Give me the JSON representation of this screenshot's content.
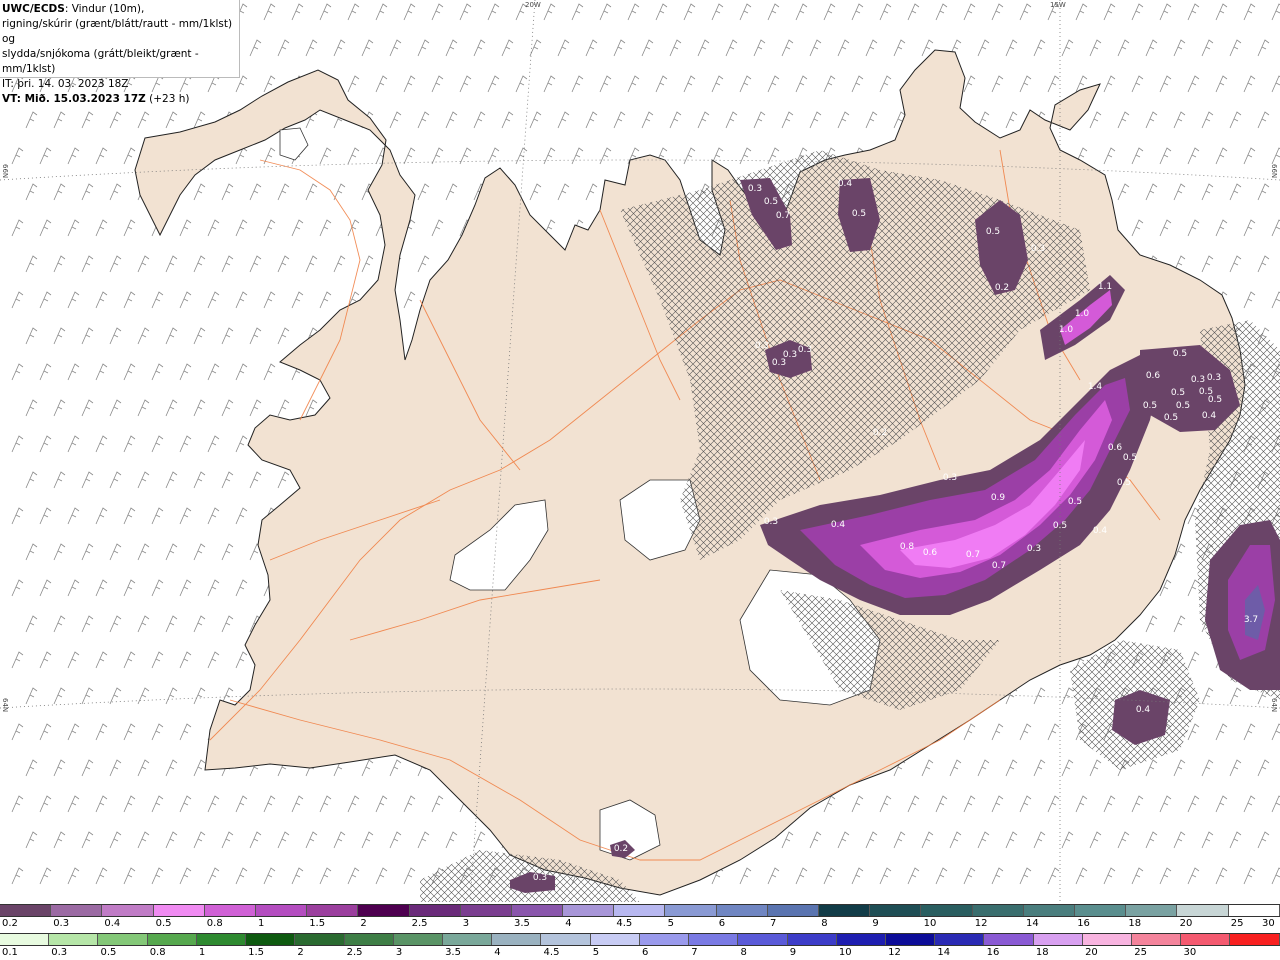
{
  "header": {
    "product": "UWC/ECDS",
    "line1_rest": ": Vindur (10m),",
    "line2": "rigning/skúrir (grænt/blátt/rautt - mm/1klst) og",
    "line3": "slydda/snjókoma (grátt/bleikt/grænt - mm/1klst)",
    "line4": "IT: þri. 14. 03. 2023 18Z",
    "line5_bold": "VT: Mið. 15.03.2023 17Z",
    "line5_rest": " (+23 h)"
  },
  "graticule": {
    "lon_labels": [
      "20W",
      "15W"
    ],
    "lat_labels": [
      "66N",
      "64N"
    ]
  },
  "precip_labels": [
    "0.3",
    "0.5",
    "0.7",
    "0.4",
    "0.5",
    "0.5",
    "0.3",
    "0.2",
    "1.1",
    "1.0",
    "1.0",
    "0.3",
    "0.3",
    "0.3",
    "0.3",
    "0.2",
    "0.5",
    "0.6",
    "0.3",
    "0.3",
    "1.4",
    "0.5",
    "0.5",
    "0.5",
    "0.4",
    "0.5",
    "0.5",
    "0.5",
    "0.6",
    "0.5",
    "0.5",
    "0.3",
    "0.3",
    "0.4",
    "0.9",
    "0.5",
    "0.5",
    "0.4",
    "0.8",
    "0.6",
    "0.7",
    "0.7",
    "0.3",
    "3.7",
    "0.4",
    "0.2",
    "0.3"
  ],
  "colors": {
    "land": "#f2e2d2",
    "roads": "#f07a3c",
    "ice": "#ffffff",
    "snow_light": "#6a4468",
    "snow_mid": "#9b3fa6",
    "snow_high": "#d45ad8",
    "snow_peak": "#f07cf4"
  },
  "scale_top": {
    "colors": [
      "#6a4468",
      "#9b6aa3",
      "#c07cc6",
      "#f08bf2",
      "#d061d6",
      "#b44dc0",
      "#9b3f9e",
      "#4e0050",
      "#6a2a7a",
      "#7b3e90",
      "#8a56ac",
      "#a896d8",
      "#b8b8f0",
      "#8a9ad4",
      "#7086c2",
      "#5a74b0",
      "#123c48",
      "#1f4e55",
      "#2a5e60",
      "#3a6e6e",
      "#4a7e7e",
      "#5a8e8e",
      "#7aa2a2",
      "#c8d6d6",
      "#ffffff"
    ],
    "labels": [
      "0.2",
      "0.3",
      "0.4",
      "0.5",
      "0.8",
      "1",
      "1.5",
      "2",
      "2.5",
      "3",
      "3.5",
      "4",
      "4.5",
      "5",
      "6",
      "7",
      "8",
      "9",
      "10",
      "12",
      "14",
      "16",
      "18",
      "20",
      "25",
      "30"
    ]
  },
  "scale_bottom": {
    "colors": [
      "#e8fbe0",
      "#b6e6a8",
      "#84c878",
      "#56a84e",
      "#2e8a30",
      "#0e5a10",
      "#2a6a30",
      "#3e7e46",
      "#5a9466",
      "#7aa89a",
      "#9ab2c0",
      "#b4c4dc",
      "#c8ccf4",
      "#9a9aec",
      "#7a7ae4",
      "#5a5ad8",
      "#3c3cc8",
      "#1e1eb0",
      "#0c0c98",
      "#2a2ab4",
      "#8a5ad4",
      "#d8a0f0",
      "#f8b4e0",
      "#f4849c",
      "#f45a70",
      "#f82020"
    ],
    "labels": [
      "0.1",
      "0.3",
      "0.5",
      "0.8",
      "1",
      "1.5",
      "2",
      "2.5",
      "3",
      "3.5",
      "4",
      "4.5",
      "5",
      "6",
      "7",
      "8",
      "9",
      "10",
      "12",
      "14",
      "16",
      "18",
      "20",
      "25",
      "30"
    ]
  }
}
